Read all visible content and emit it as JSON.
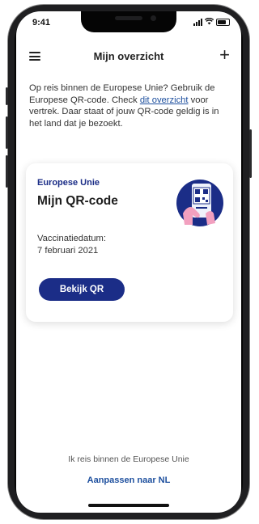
{
  "status_bar": {
    "time": "9:41"
  },
  "header": {
    "title": "Mijn overzicht"
  },
  "intro": {
    "text_before": "Op reis binnen de Europese Unie? Gebruik de Europese QR-code. Check ",
    "link": "dit overzicht",
    "text_after": " voor vertrek. Daar staat of jouw QR-code geldig is in het land dat je bezoekt."
  },
  "card": {
    "eyebrow": "Europese Unie",
    "title": "Mijn QR-code",
    "vaccination_label": "Vaccinatiedatum:",
    "vaccination_date": "7 februari 2021",
    "button_label": "Bekijk QR"
  },
  "footer": {
    "text": "Ik reis binnen de Europese Unie",
    "link": "Aanpassen naar NL"
  },
  "colors": {
    "brand_blue": "#1b2d87",
    "link_blue": "#1d4f9e",
    "illustration_pink": "#f2a0bf"
  },
  "icons": [
    "menu-icon",
    "plus-icon",
    "signal-icon",
    "wifi-icon",
    "battery-icon",
    "qr-phone-illustration"
  ]
}
